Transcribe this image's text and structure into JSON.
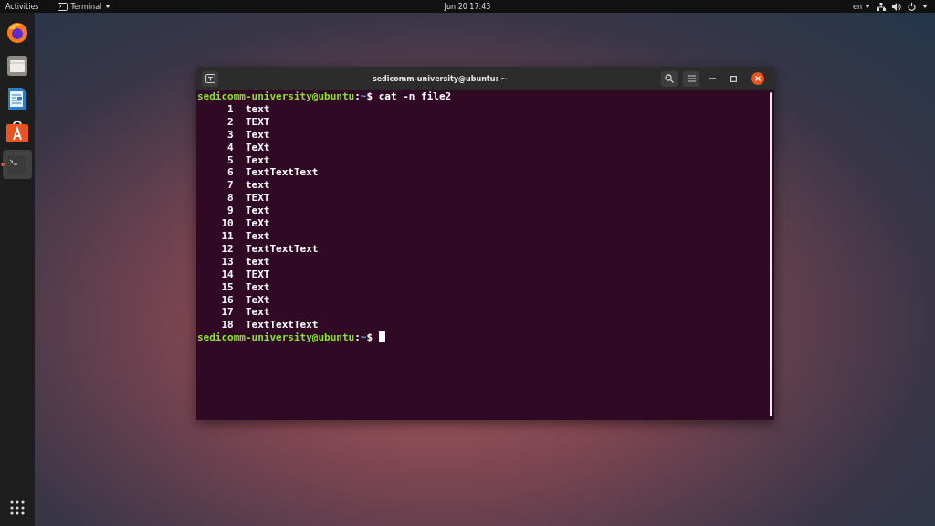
{
  "top_bar": {
    "activities": "Activities",
    "app_menu": "Terminal",
    "clock": "Jun 20  17:43",
    "keyboard": "en"
  },
  "dock": {
    "items": [
      {
        "kind": "browser",
        "selected": false
      },
      {
        "kind": "files",
        "selected": false
      },
      {
        "kind": "writer",
        "selected": false
      },
      {
        "kind": "software",
        "selected": false
      },
      {
        "kind": "terminal",
        "selected": true
      }
    ]
  },
  "terminal": {
    "title": "sedicomm-university@ubuntu: ~",
    "prompts": [
      {
        "user_host": "sedicomm-university@ubuntu",
        "separator": ":",
        "path": "~",
        "symbol": "$",
        "command": "cat -n file2",
        "cursor": false
      },
      {
        "user_host": "sedicomm-university@ubuntu",
        "separator": ":",
        "path": "~",
        "symbol": "$",
        "cursor": true
      }
    ],
    "output": [
      {
        "number": "1",
        "text": "text"
      },
      {
        "number": "2",
        "text": "TEXT"
      },
      {
        "number": "3",
        "text": "Text"
      },
      {
        "number": "4",
        "text": "TeXt"
      },
      {
        "number": "5",
        "text": "Text"
      },
      {
        "number": "6",
        "text": "TextTextText"
      },
      {
        "number": "7",
        "text": "text"
      },
      {
        "number": "8",
        "text": "TEXT"
      },
      {
        "number": "9",
        "text": "Text"
      },
      {
        "number": "10",
        "text": "TeXt"
      },
      {
        "number": "11",
        "text": "Text"
      },
      {
        "number": "12",
        "text": "TextTextText"
      },
      {
        "number": "13",
        "text": "text"
      },
      {
        "number": "14",
        "text": "TEXT"
      },
      {
        "number": "15",
        "text": "Text"
      },
      {
        "number": "16",
        "text": "TeXt"
      },
      {
        "number": "17",
        "text": "Text"
      },
      {
        "number": "18",
        "text": "TextTextText"
      }
    ]
  }
}
